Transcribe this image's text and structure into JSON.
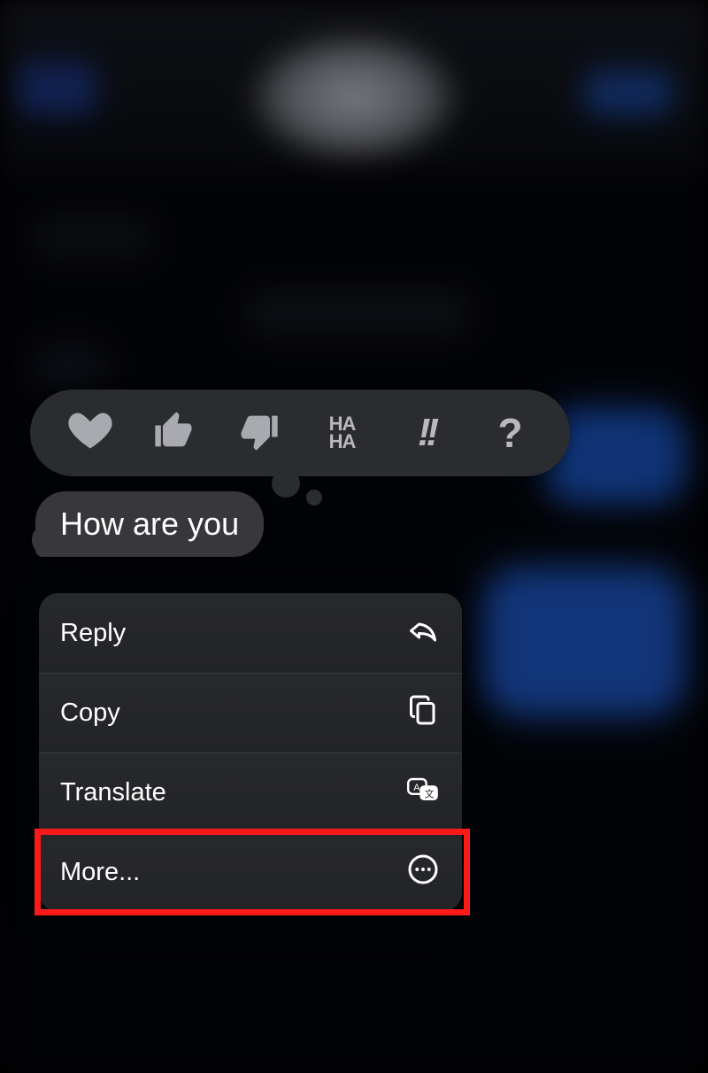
{
  "message": {
    "text": "How are you"
  },
  "tapbacks": [
    {
      "name": "heart"
    },
    {
      "name": "thumbs-up"
    },
    {
      "name": "thumbs-down"
    },
    {
      "name": "haha",
      "top": "HA",
      "bottom": "HA"
    },
    {
      "name": "exclaim",
      "glyph": "!!"
    },
    {
      "name": "question",
      "glyph": "?"
    }
  ],
  "menu": {
    "reply": "Reply",
    "copy": "Copy",
    "translate": "Translate",
    "more": "More..."
  }
}
